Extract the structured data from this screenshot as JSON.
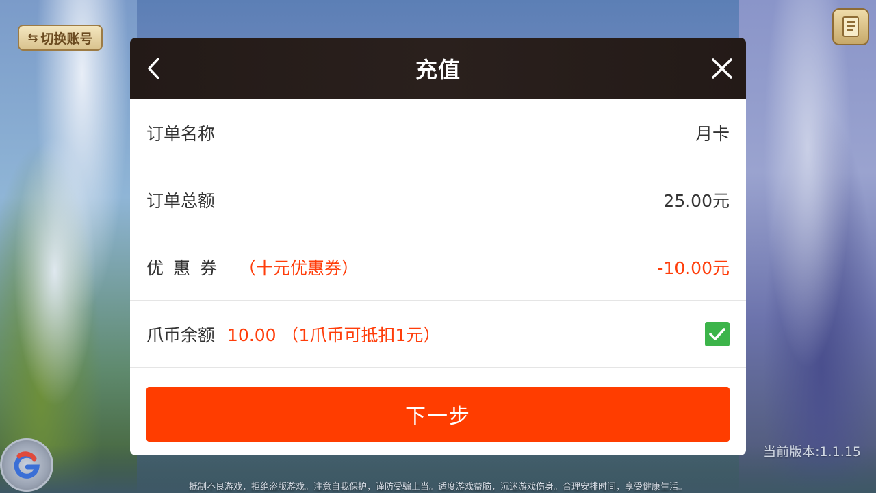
{
  "background": {
    "switch_account_label": "切换账号",
    "version_text": "当前版本:1.1.15",
    "health_notice": "抵制不良游戏，拒绝盗版游戏。注意自我保护，谨防受骗上当。适度游戏益脑，沉迷游戏伤身。合理安排时间，享受健康生活。"
  },
  "dialog": {
    "title": "充值",
    "rows": [
      {
        "label": "订单名称",
        "value": "月卡"
      },
      {
        "label": "订单总额",
        "value": "25.00元"
      },
      {
        "label": "优惠券",
        "extra": "（十元优惠券）",
        "value": "-10.00元"
      },
      {
        "label": "爪币余额",
        "extra": "10.00 （1爪币可抵扣1元）",
        "checked": true
      }
    ],
    "next_button_label": "下一步"
  },
  "colors": {
    "accent": "#ff3d00",
    "highlight_text": "#ff3d0a",
    "checkbox_green": "#3cb44a",
    "header_bg": "#231a17"
  }
}
